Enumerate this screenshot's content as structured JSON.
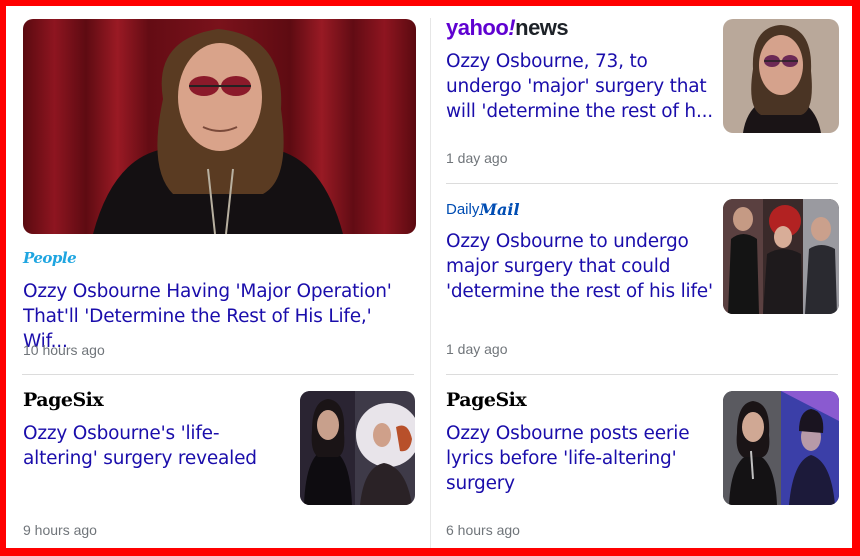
{
  "cards": [
    {
      "source": "People",
      "title": "Ozzy Osbourne Having 'Major Operation' That'll 'Determine the Rest of His Life,' Wif...",
      "time": "10 hours ago"
    },
    {
      "source_brand": "yahoo",
      "source_sub": "news",
      "title": "Ozzy Osbourne, 73, to undergo 'major' surgery that will 'determine the rest of h...",
      "time": "1 day ago"
    },
    {
      "source_prefix": "Daily",
      "source_main": "Mail",
      "title": "Ozzy Osbourne to undergo major surgery that could 'determine the rest of his life'",
      "time": "1 day ago"
    },
    {
      "source": "PageSix",
      "title": "Ozzy Osbourne's 'life-altering' surgery revealed",
      "time": "9 hours ago"
    },
    {
      "source": "PageSix",
      "title": "Ozzy Osbourne posts eerie lyrics before 'life-altering' surgery",
      "time": "6 hours ago"
    }
  ],
  "colors": {
    "frame_border": "#ff0000",
    "headline_link": "#1a0dab",
    "timestamp": "#70757a",
    "yahoo_purple": "#5f01d1",
    "people_blue": "#1fa5e0",
    "dailymail_blue": "#004db3"
  }
}
